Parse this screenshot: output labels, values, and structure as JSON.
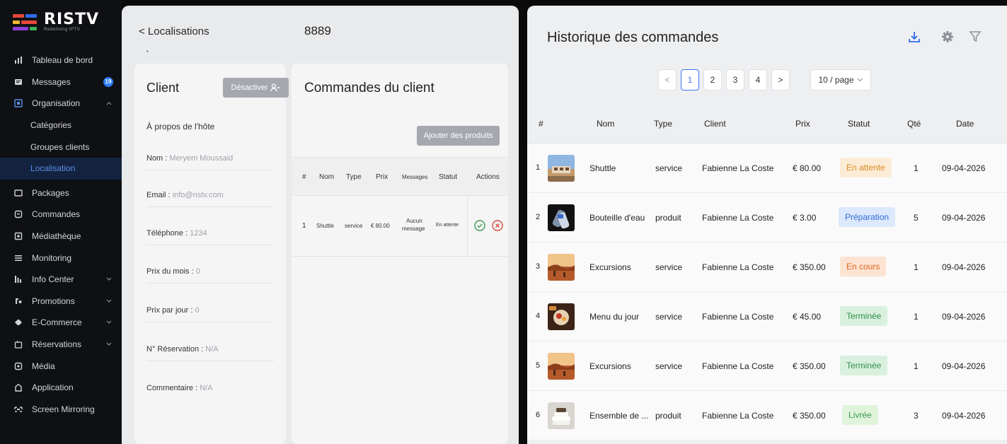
{
  "brand": {
    "name": "RISTV",
    "tagline": "Redefining IPTV",
    "colors": [
      "#e4473a",
      "#2f6bf0",
      "#f5b731",
      "#3fb35f",
      "#8e3fd8"
    ]
  },
  "sidebar": {
    "items": [
      {
        "label": "Tableau de bord",
        "icon": "dashboard-icon"
      },
      {
        "label": "Messages",
        "icon": "messages-icon",
        "badge": "19"
      },
      {
        "label": "Organisation",
        "icon": "organisation-icon",
        "chevron": "^"
      },
      {
        "label": "Catégories",
        "sub": true
      },
      {
        "label": "Groupes clients",
        "sub": true
      },
      {
        "label": "Localisation",
        "sub": true,
        "active": true
      },
      {
        "label": "Packages",
        "icon": "packages-icon"
      },
      {
        "label": "Commandes",
        "icon": "commandes-icon"
      },
      {
        "label": "Médiathèque",
        "icon": "mediatheque-icon"
      },
      {
        "label": "Monitoring",
        "icon": "monitoring-icon"
      },
      {
        "label": "Info Center",
        "icon": "info-center-icon",
        "chevron": "v"
      },
      {
        "label": "Promotions",
        "icon": "promotions-icon",
        "chevron": "v"
      },
      {
        "label": "E-Commerce",
        "icon": "ecommerce-icon",
        "chevron": "v"
      },
      {
        "label": "Réservations",
        "icon": "reservations-icon",
        "chevron": "v"
      },
      {
        "label": "Média",
        "icon": "media-icon"
      },
      {
        "label": "Application",
        "icon": "application-icon"
      },
      {
        "label": "Screen Mirroring",
        "icon": "screen-mirroring-icon"
      }
    ]
  },
  "header": {
    "back_label": "< Localisations",
    "order_id": "8889",
    "dot": "•"
  },
  "client": {
    "title": "Client",
    "deactivate_label": "Désactiver",
    "about": "À propos de l'hôte",
    "fields": [
      {
        "label": "Nom : ",
        "value": "Meryem Moussaid"
      },
      {
        "label": "Email : ",
        "value": "info@ristv.com"
      },
      {
        "label": "Téléphone : ",
        "value": "1234"
      },
      {
        "label": "Prix du mois : ",
        "value": "0"
      },
      {
        "label": "Prix par jour : ",
        "value": "0"
      },
      {
        "label": "N° Réservation : ",
        "value": "N/A"
      },
      {
        "label": "Commentaire : ",
        "value": "N/A"
      }
    ]
  },
  "client_orders": {
    "title": "Commandes du client",
    "add_label": "Ajouter des produits",
    "columns": [
      "#",
      "Nom",
      "Type",
      "Prix",
      "Messages",
      "Statut",
      "Actions"
    ],
    "rows": [
      {
        "num": "1",
        "nom": "Shuttle",
        "type": "service",
        "prix": "€ 80.00",
        "messages_1": "Aucun",
        "messages_2": "message",
        "statut": "En attente"
      }
    ]
  },
  "history": {
    "title": "Historique des commandes",
    "toolbar_icons": [
      "download-icon",
      "settings-icon",
      "filter-icon"
    ],
    "pagination": {
      "prev": "<",
      "pages": [
        "1",
        "2",
        "3",
        "4"
      ],
      "current": "1",
      "next": ">",
      "page_size": "10 / page"
    },
    "columns": [
      "#",
      "Nom",
      "Type",
      "Client",
      "Prix",
      "Statut",
      "Qté",
      "Date"
    ],
    "rows": [
      {
        "num": "1",
        "nom": "Shuttle",
        "type": "service",
        "client": "Fabienne La Coste",
        "prix": "€ 80.00",
        "statut": "En attente",
        "qte": "1",
        "date": "09-04-2026",
        "status_color": "#d98a1f",
        "status_bg": "#fcecd6",
        "thumb": "shuttle"
      },
      {
        "num": "2",
        "nom": "Bouteille d'eau",
        "type": "produit",
        "client": "Fabienne La Coste",
        "prix": "€ 3.00",
        "statut": "Préparation",
        "qte": "5",
        "date": "09-04-2026",
        "status_color": "#2f6bd8",
        "status_bg": "#dce8fb",
        "thumb": "bottle"
      },
      {
        "num": "3",
        "nom": "Excursions",
        "type": "service",
        "client": "Fabienne La Coste",
        "prix": "€ 350.00",
        "statut": "En cours",
        "qte": "1",
        "date": "09-04-2026",
        "status_color": "#e2661a",
        "status_bg": "#fde3d2",
        "thumb": "desert"
      },
      {
        "num": "4",
        "nom": "Menu du jour",
        "type": "service",
        "client": "Fabienne La Coste",
        "prix": "€ 45.00",
        "statut": "Terminée",
        "qte": "1",
        "date": "09-04-2026",
        "status_color": "#2f8f4a",
        "status_bg": "#d9f0de",
        "thumb": "food"
      },
      {
        "num": "5",
        "nom": "Excursions",
        "type": "service",
        "client": "Fabienne La Coste",
        "prix": "€ 350.00",
        "statut": "Terminée",
        "qte": "1",
        "date": "09-04-2026",
        "status_color": "#2f8f4a",
        "status_bg": "#d9f0de",
        "thumb": "desert"
      },
      {
        "num": "6",
        "nom": "Ensemble de ...",
        "type": "produit",
        "client": "Fabienne La Coste",
        "prix": "€ 350.00",
        "statut": "Livrée",
        "qte": "3",
        "date": "09-04-2026",
        "status_color": "#3a9b4f",
        "status_bg": "#e0f4dc",
        "thumb": "towels"
      }
    ]
  }
}
